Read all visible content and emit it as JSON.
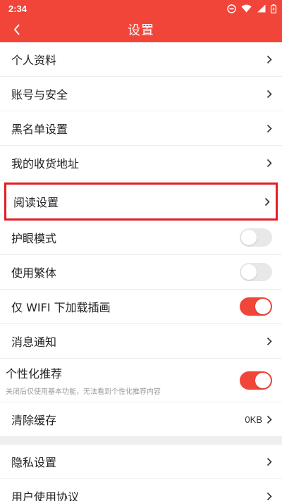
{
  "status_bar": {
    "time": "2:34"
  },
  "header": {
    "title": "设置"
  },
  "section1": [
    {
      "label": "个人资料"
    },
    {
      "label": "账号与安全"
    },
    {
      "label": "黑名单设置"
    },
    {
      "label": "我的收货地址"
    }
  ],
  "reading": {
    "label": "阅读设置"
  },
  "toggles": [
    {
      "label": "护眼模式",
      "state": "off"
    },
    {
      "label": "使用繁体",
      "state": "off"
    },
    {
      "label": "仅 WIFI 下加载插画",
      "state": "on"
    }
  ],
  "notification": {
    "label": "消息通知"
  },
  "personalized": {
    "label": "个性化推荐",
    "sub": "关闭后仅使用基本功能，无法看到个性化推荐内容",
    "state": "on"
  },
  "cache": {
    "label": "清除缓存",
    "value": "0KB"
  },
  "section2": [
    {
      "label": "隐私设置"
    },
    {
      "label": "用户使用协议"
    }
  ],
  "colors": {
    "accent": "#f2453a",
    "highlight_border": "#e41c24"
  }
}
